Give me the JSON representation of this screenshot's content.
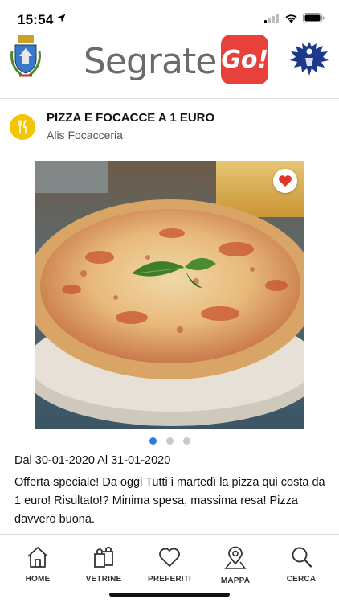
{
  "status_bar": {
    "time": "15:54"
  },
  "header": {
    "logo_text": "Segrate",
    "logo_badge": "Go!",
    "left_emblem": "municipal-crest-icon",
    "right_emblem": "eagle-icon",
    "colors": {
      "logo_text": "#6b6b6b",
      "badge": "#e8403a"
    }
  },
  "offer": {
    "title": "PIZZA E FOCACCE A 1 EURO",
    "vendor": "Alis Focacceria",
    "category_icon": "fork-knife-icon",
    "favorite_icon": "heart-icon",
    "carousel": {
      "count": 3,
      "active": 1
    },
    "dates": "Dal 30-01-2020 Al 31-01-2020",
    "description": "Offerta speciale! Da oggi Tutti i martedì la pizza qui costa da 1 euro! Risultato!? Minima spesa, massima resa! Pizza davvero buona."
  },
  "tabbar": {
    "items": [
      {
        "label": "HOME",
        "icon": "home-icon"
      },
      {
        "label": "VETRINE",
        "icon": "shopping-bags-icon"
      },
      {
        "label": "PREFERITI",
        "icon": "heart-outline-icon"
      },
      {
        "label": "MAPPA",
        "icon": "map-pin-icon"
      },
      {
        "label": "CERCA",
        "icon": "search-icon"
      }
    ]
  }
}
